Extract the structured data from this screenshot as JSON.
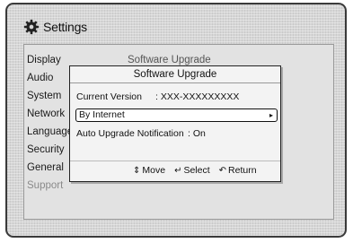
{
  "header": {
    "title": "Settings",
    "icon": "gear-icon"
  },
  "menu": {
    "items": [
      {
        "label": "Display"
      },
      {
        "label": "Audio"
      },
      {
        "label": "System"
      },
      {
        "label": "Network"
      },
      {
        "label": "Language"
      },
      {
        "label": "Security"
      },
      {
        "label": "General"
      },
      {
        "label": "Support"
      }
    ]
  },
  "submenu": {
    "label": "Software Upgrade"
  },
  "dialog": {
    "title": "Software Upgrade",
    "current_version_label": "Current Version",
    "current_version_value": ": XXX-XXXXXXXXX",
    "by_internet_label": "By Internet",
    "auto_upgrade_label": "Auto Upgrade Notification",
    "auto_upgrade_value": ": On"
  },
  "footer": {
    "move_label": "Move",
    "select_label": "Select",
    "return_label": "Return",
    "move_icon": "up-down-arrows-icon",
    "select_icon": "enter-icon",
    "return_icon": "return-arrow-icon"
  }
}
